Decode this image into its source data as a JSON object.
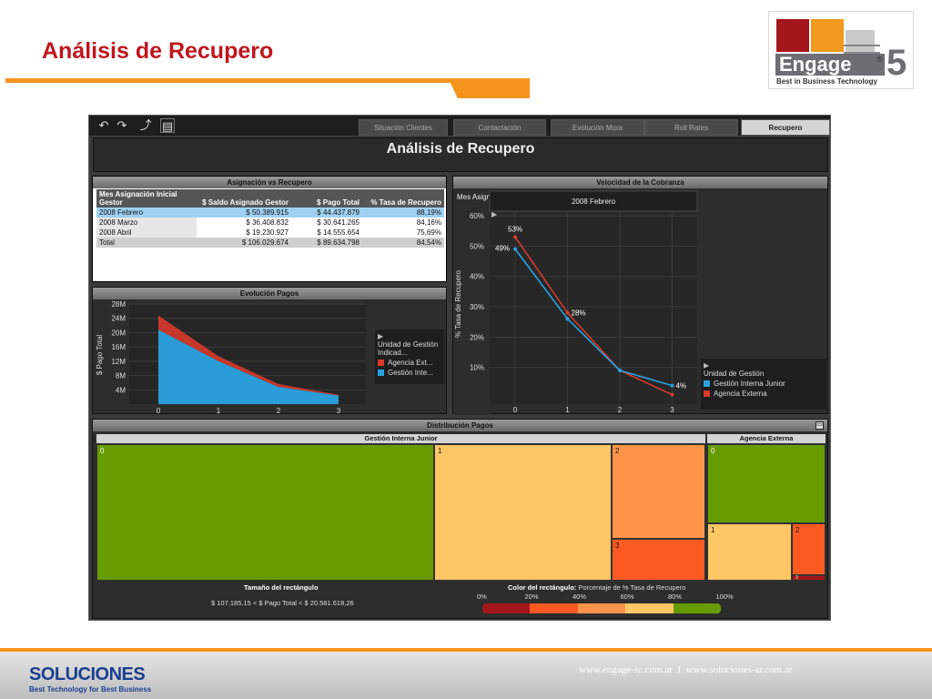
{
  "slide": {
    "title": "Análisis de Recupero"
  },
  "logo": {
    "word": "Engage",
    "version": "5",
    "tagline": "Best in Business Technology"
  },
  "toolbar": {
    "undo_icon": "undo-icon",
    "redo_icon": "redo-icon",
    "reset_icon": "reset-icon",
    "comment_icon": "comment-icon"
  },
  "tabs": [
    {
      "label": "Situación Clientes"
    },
    {
      "label": "Contactación"
    },
    {
      "label": "Evolución Mora"
    },
    {
      "label": "Roll Rates"
    },
    {
      "label": "Recupero"
    }
  ],
  "dashboard": {
    "title": "Análisis de Recupero"
  },
  "table": {
    "title": "Asignación vs Recupero",
    "headers": [
      "Mes Asignación Inicial Gestor",
      "$ Saldo Asignado Gestor",
      "$ Pago Total",
      "% Tasa de Recupero"
    ],
    "rows": [
      [
        "2008 Febrero",
        "$ 50.389.915",
        "$ 44.437.879",
        "88,19%"
      ],
      [
        "2008 Marzo",
        "$ 36.408.832",
        "$ 30.641.265",
        "84,16%"
      ],
      [
        "2008 Abril",
        "$ 19.230.927",
        "$ 14.555.654",
        "75,69%"
      ],
      [
        "Total",
        "$ 106.029.674",
        "$ 89.634.798",
        "84,54%"
      ]
    ]
  },
  "evolucion": {
    "title": "Evolución Pagos",
    "ylabel": "$ Pago Total",
    "yticks": [
      "28M",
      "24M",
      "20M",
      "16M",
      "12M",
      "8M",
      "4M"
    ],
    "xticks": [
      "0",
      "1",
      "2",
      "3"
    ],
    "legend_title": "Unidad de Gestión Indicad...",
    "legend_items": [
      "Agencia Ext...",
      "Gestión Inte..."
    ]
  },
  "velocidad": {
    "title": "Velocidad de la Cobranza",
    "row_header": "Mes Asign...",
    "col_header": "2008 Febrero",
    "ylabel": "% Tasa de Recupero",
    "yticks": [
      "60%",
      "50%",
      "40%",
      "30%",
      "20%",
      "10%"
    ],
    "xticks": [
      "0",
      "1",
      "2",
      "3"
    ],
    "point_labels": [
      "53%",
      "49%",
      "28%",
      "4%"
    ],
    "legend_title": "Unidad de Gestión",
    "legend_items": [
      "Gestión Interna Junior",
      "Agencia Externa"
    ]
  },
  "distribucion": {
    "title": "Distribución Pagos",
    "group1": "Gestión Interna Junior",
    "group2": "Agencia Externa",
    "cells": [
      "0",
      "1",
      "2",
      "3",
      "0",
      "1",
      "2",
      "3"
    ],
    "size_label": "Tamaño del rectángulo",
    "size_range": "$ 107.185,15 < $ Pago Total < $ 20.581.618,26",
    "color_label_bold": "Color del rectángulo:",
    "color_label": "Porcentaje de % Tasa de Recupero",
    "scale": [
      "0%",
      "20%",
      "40%",
      "60%",
      "80%",
      "100%"
    ]
  },
  "colors": {
    "red": "#d93a2b",
    "blue": "#2aa2e0",
    "green": "#669c00",
    "light_orange": "#fec665",
    "orange": "#fd944a",
    "dark_orange": "#fd5a23"
  },
  "chart_data": [
    {
      "type": "area",
      "title": "Evolución Pagos",
      "ylabel": "$ Pago Total",
      "x": [
        0,
        1,
        2,
        3
      ],
      "ylim": [
        0,
        28000000
      ],
      "series": [
        {
          "name": "Gestión Inte...",
          "values": [
            20800000,
            12000000,
            4800000,
            2400000
          ]
        },
        {
          "name": "Agencia Ext...",
          "values": [
            4000000,
            1400000,
            800000,
            200000
          ]
        }
      ]
    },
    {
      "type": "line",
      "title": "Velocidad de la Cobranza",
      "ylabel": "% Tasa de Recupero",
      "x": [
        0,
        1,
        2,
        3
      ],
      "ylim": [
        0,
        60
      ],
      "series": [
        {
          "name": "Agencia Externa",
          "values": [
            53,
            28,
            9,
            1
          ]
        },
        {
          "name": "Gestión Interna Junior",
          "values": [
            49,
            26,
            9,
            4
          ]
        }
      ]
    }
  ]
}
